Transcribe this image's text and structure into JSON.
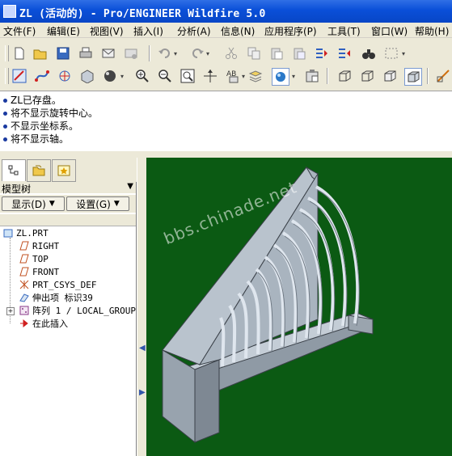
{
  "window": {
    "title": "ZL (活动的) - Pro/ENGINEER Wildfire 5.0"
  },
  "menu": [
    {
      "label": "文件(F)"
    },
    {
      "label": "编辑(E)"
    },
    {
      "label": "视图(V)"
    },
    {
      "label": "插入(I)"
    },
    {
      "label": "分析(A)"
    },
    {
      "label": "信息(N)"
    },
    {
      "label": "应用程序(P)"
    },
    {
      "label": "工具(T)"
    },
    {
      "label": "窗口(W)"
    },
    {
      "label": "帮助(H)"
    }
  ],
  "messages": [
    "ZL已存盘。",
    "将不显示旋转中心。",
    "不显示坐标系。",
    "将不显示轴。"
  ],
  "navigator": {
    "header": "模型树",
    "show_button": "显示(D)",
    "settings_button": "设置(G)",
    "tree": [
      {
        "label": "ZL.PRT",
        "icon": "part-icon"
      },
      {
        "label": "RIGHT",
        "icon": "datum-plane-icon"
      },
      {
        "label": "TOP",
        "icon": "datum-plane-icon"
      },
      {
        "label": "FRONT",
        "icon": "datum-plane-icon"
      },
      {
        "label": "PRT_CSYS_DEF",
        "icon": "csys-icon"
      },
      {
        "label": "伸出项 标识39",
        "icon": "extrude-icon"
      },
      {
        "label": "阵列 1 / LOCAL_GROUP",
        "icon": "pattern-icon"
      },
      {
        "label": "在此插入",
        "icon": "insert-here-icon"
      }
    ]
  },
  "viewport": {
    "watermark": "bbs.chinade.net",
    "background": "#0b5a13"
  },
  "colors": {
    "titlebar": "#0a4fd8",
    "model_face": "#b9c3cd",
    "model_dark": "#8f9aa5"
  }
}
